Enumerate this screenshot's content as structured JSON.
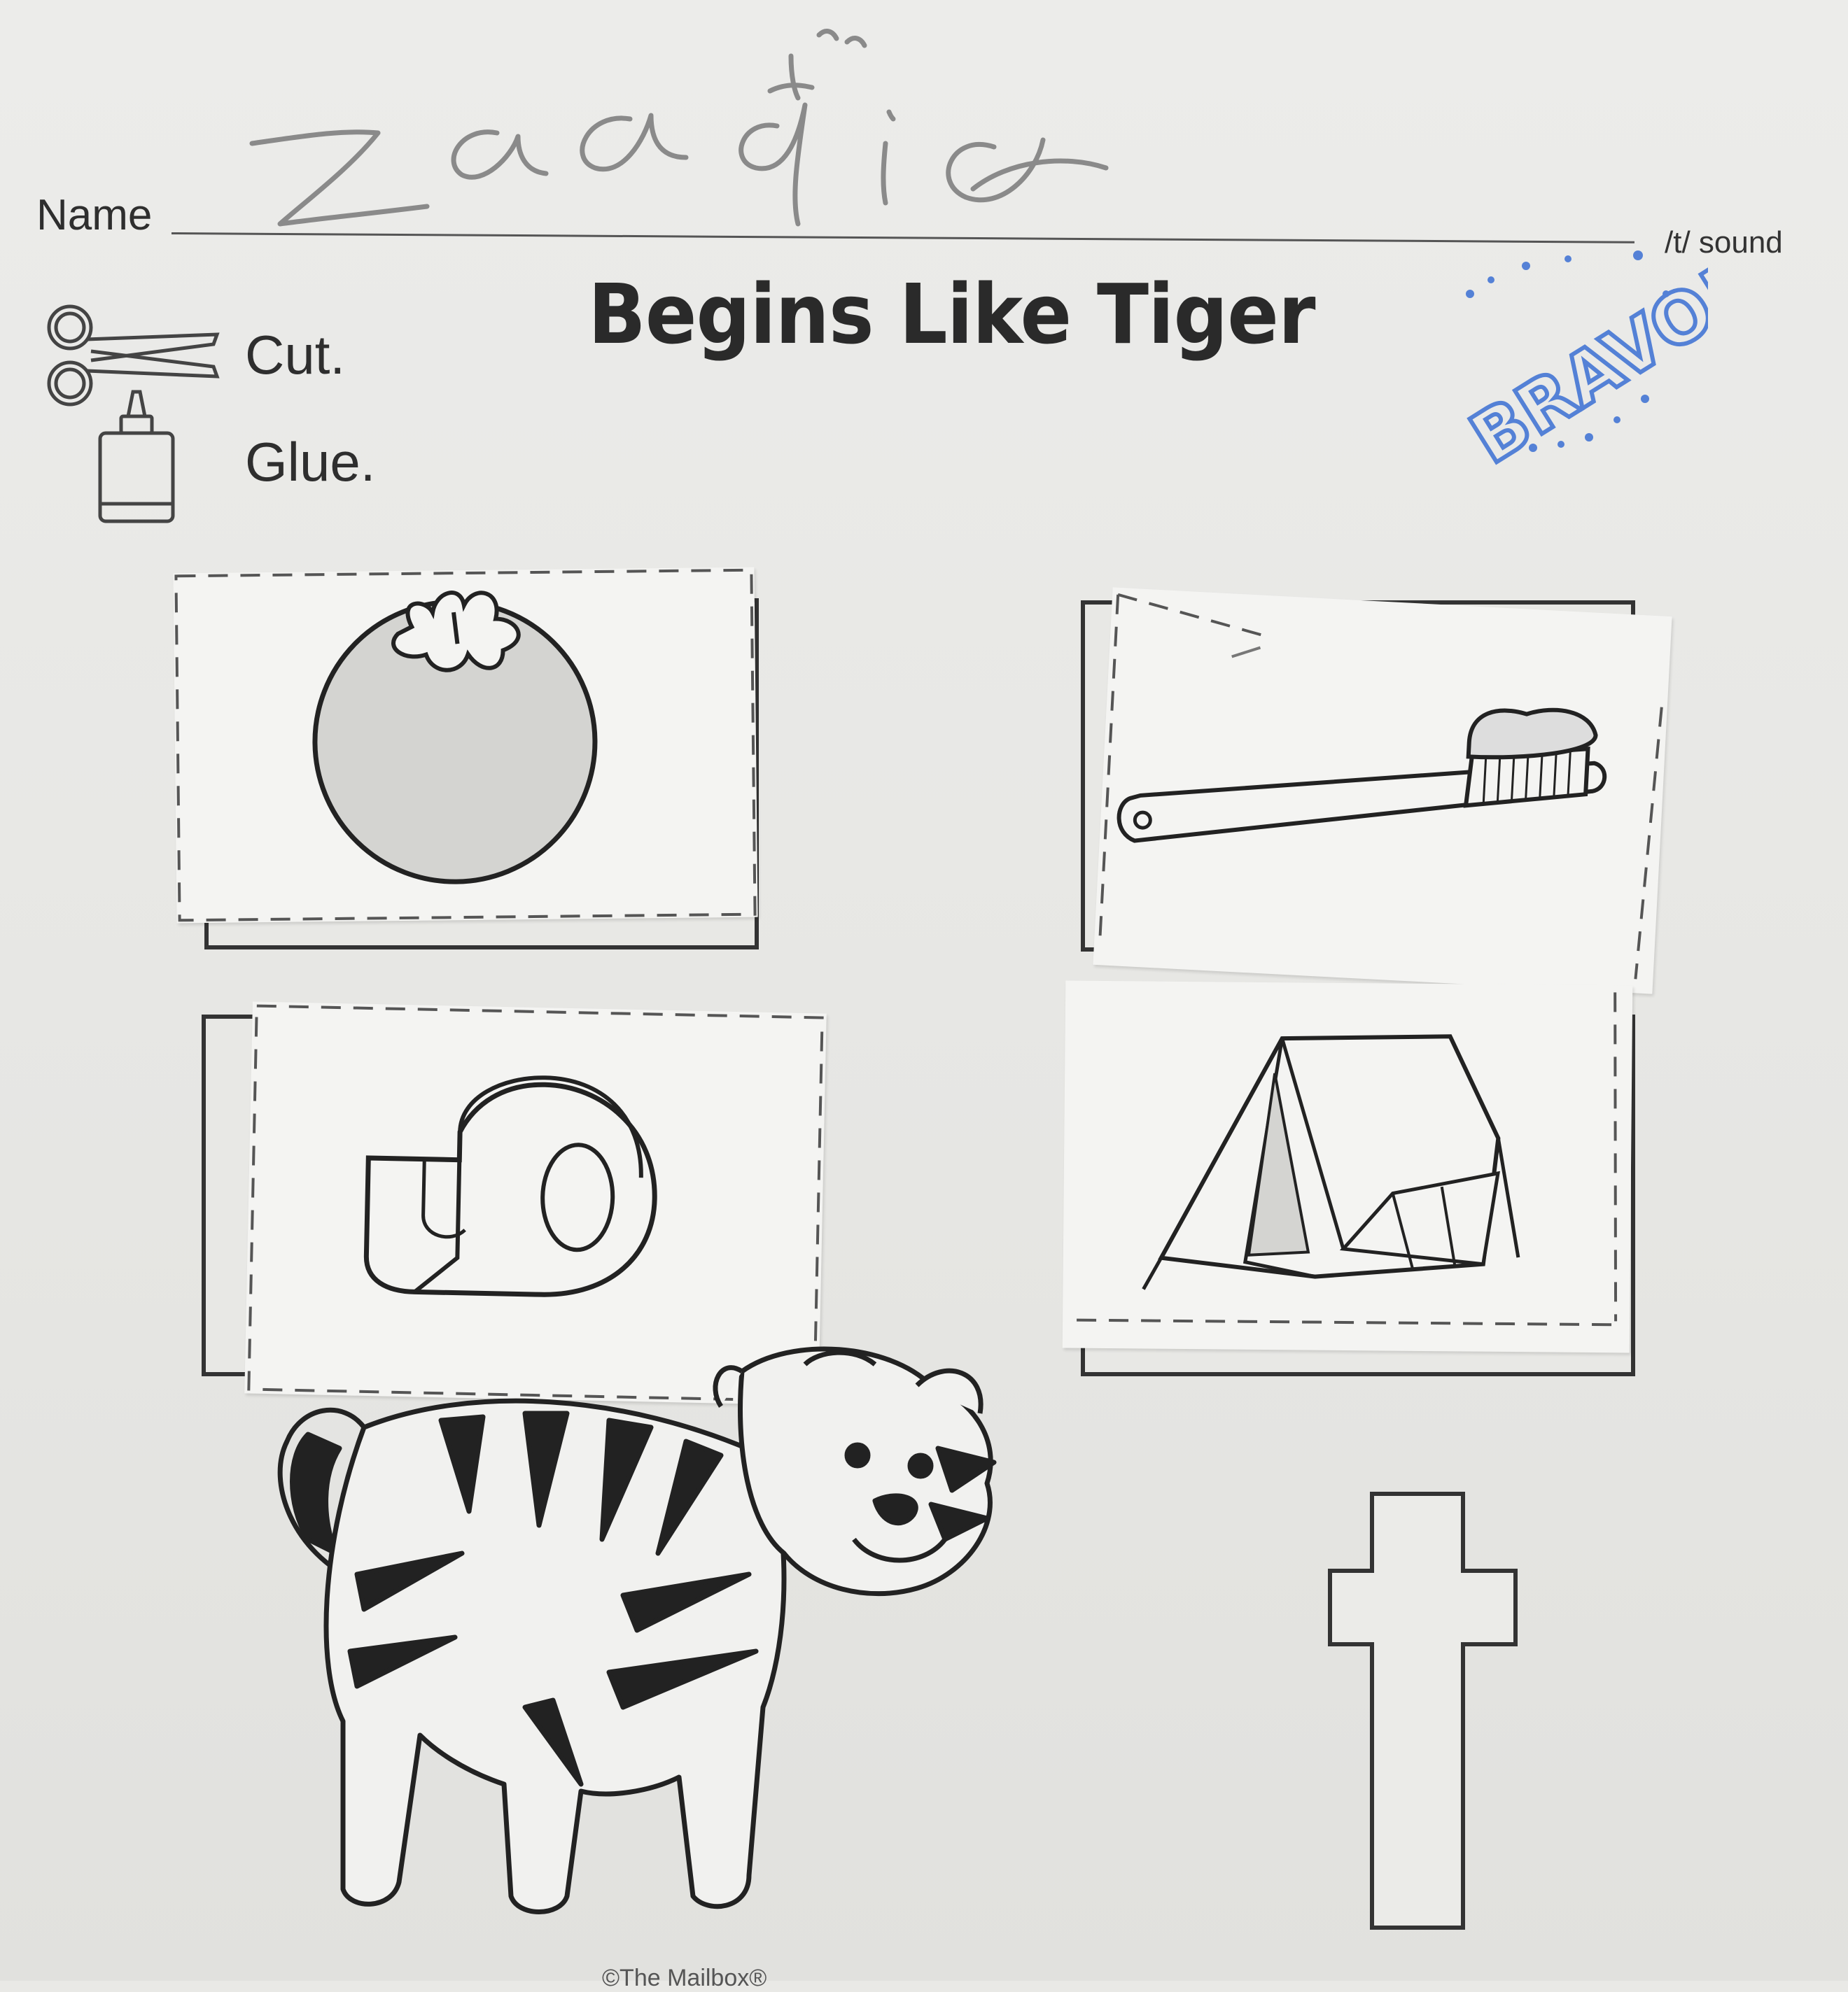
{
  "header": {
    "name_label": "Name",
    "student_name": "Zaafia",
    "sound_label": "/t/ sound",
    "title": "Begins Like Tiger"
  },
  "stamp": {
    "text": "BRAVO!",
    "color": "#3b6fd4"
  },
  "instructions": [
    {
      "icon": "scissors-icon",
      "label": "Cut."
    },
    {
      "icon": "glue-bottle-icon",
      "label": "Glue."
    }
  ],
  "cards": [
    {
      "picture": "tomato"
    },
    {
      "picture": "toothbrush"
    },
    {
      "picture": "tape"
    },
    {
      "picture": "tent"
    }
  ],
  "bottom": {
    "picture": "tiger",
    "letter": "t"
  },
  "footer": {
    "text": "©The Mailbox®"
  }
}
